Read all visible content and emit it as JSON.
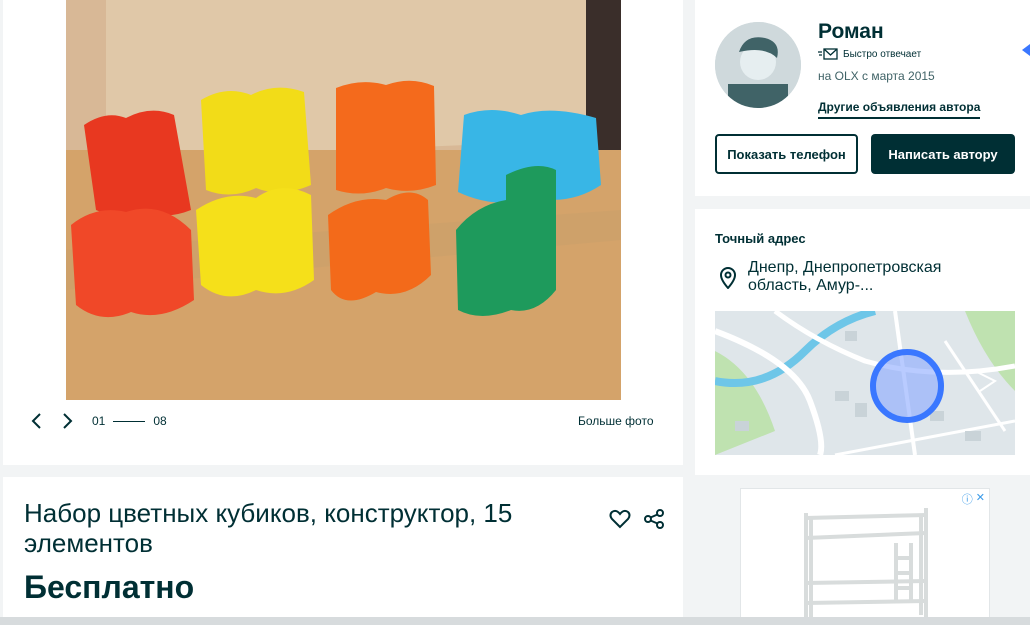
{
  "gallery": {
    "current": "01",
    "total": "08",
    "bigger_photo_label": "Больше фото",
    "photo_description": "Набор цветных кубиков"
  },
  "listing": {
    "title": "Набор цветных кубиков, конструктор, 15 элементов",
    "price": "Бесплатно"
  },
  "seller": {
    "name": "Роман",
    "fast_reply": "Быстро отвечает",
    "since": "на OLX с марта 2015",
    "other_ads": "Другие объявления автора",
    "show_phone": "Показать телефон",
    "write_author": "Написать автору"
  },
  "address": {
    "label": "Точный адрес",
    "text": "Днепр, Днепропетровская область, Амур-..."
  },
  "colors": {
    "brand": "#002f34",
    "accent_blue": "#3a77ff",
    "background": "#f2f4f5"
  }
}
